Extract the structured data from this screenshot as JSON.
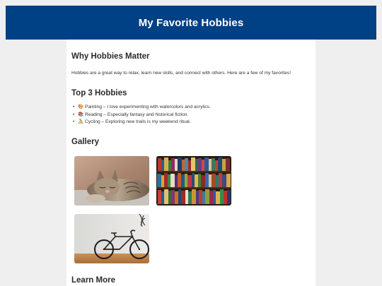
{
  "header": {
    "title": "My Favorite Hobbies"
  },
  "why": {
    "heading": "Why Hobbies Matter",
    "text": "Hobbies are a great way to relax, learn new skills, and connect with others. Here are a few of my favorites!"
  },
  "top": {
    "heading": "Top 3 Hobbies",
    "items": [
      {
        "icon": "palette-icon",
        "text": "🎨 Painting – I love experimenting with watercolors and acrylics."
      },
      {
        "icon": "books-icon",
        "text": "📚 Reading – Especially fantasy and historical fiction."
      },
      {
        "icon": "bicycle-icon",
        "text": "🚴 Cycling – Exploring new trails is my weekend ritual."
      }
    ]
  },
  "gallery": {
    "heading": "Gallery",
    "images": [
      "sleeping-cat-photo",
      "bookshelf-photo",
      "bicycle-photo"
    ]
  },
  "learn": {
    "heading": "Learn More"
  },
  "colors": {
    "header_bg": "#004085",
    "page_bg": "#efefef",
    "content_bg": "#ffffff"
  }
}
